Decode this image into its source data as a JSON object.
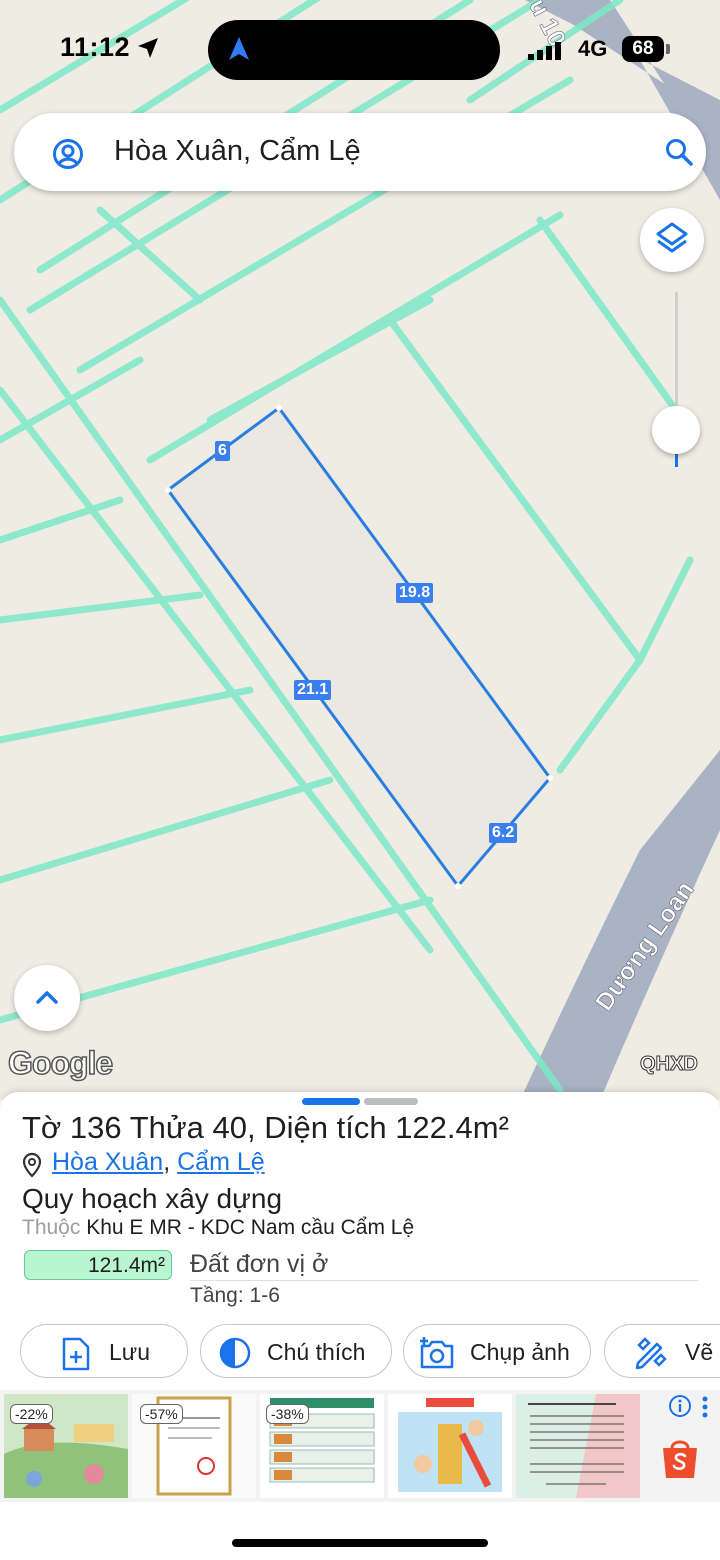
{
  "status": {
    "time": "11:12",
    "network": "4G",
    "battery": "68"
  },
  "search": {
    "text": "Hòa Xuân, Cẩm Lệ"
  },
  "map": {
    "road_label_bottom": "Dương Loan",
    "road_label_top": "u 10",
    "google_logo": "Google",
    "layer_badge": "QHXD",
    "parcel_dimensions": {
      "top": "6",
      "right": "19.8",
      "left": "21.1",
      "bottom": "6.2"
    },
    "colors": {
      "parcel_outline": "#2a7de1",
      "plan_lines": "#7de8c8",
      "road": "#a9b3c4",
      "background": "#efece4"
    }
  },
  "sheet": {
    "title_prefix": "Tờ",
    "sheet_no": "136",
    "parcel_label": "Thửa",
    "parcel_no": "40",
    "area_label": "Diện tích",
    "area_value": "122.4m²",
    "ward": "Hòa Xuân",
    "district": "Cẩm Lệ",
    "separator": ",",
    "plan_title": "Quy hoạch xây dựng",
    "belong_label": "Thuộc",
    "belong_value": "Khu E MR - KDC Nam cầu Cẩm Lệ",
    "zone_area": "121.4m²",
    "land_type": "Đất đơn vị ở",
    "floors": "Tầng: 1-6"
  },
  "actions": {
    "save": "Lưu",
    "legend": "Chú thích",
    "photo": "Chụp ảnh",
    "draw": "Vẽ"
  },
  "ads": {
    "discounts": [
      "-22%",
      "-57%",
      "-38%"
    ],
    "brand_color": "#ee4d2d"
  }
}
